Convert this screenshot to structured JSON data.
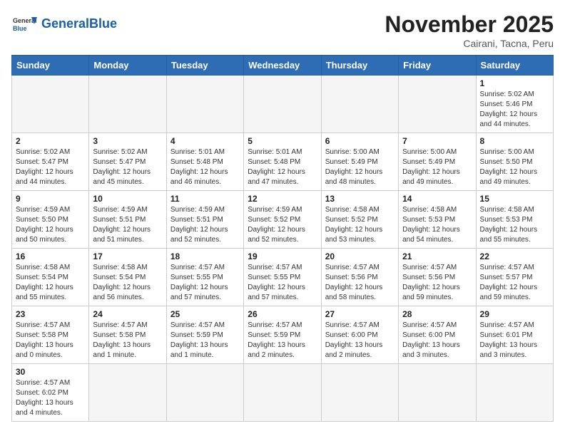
{
  "header": {
    "logo_general": "General",
    "logo_blue": "Blue",
    "month_title": "November 2025",
    "location": "Cairani, Tacna, Peru"
  },
  "weekdays": [
    "Sunday",
    "Monday",
    "Tuesday",
    "Wednesday",
    "Thursday",
    "Friday",
    "Saturday"
  ],
  "days": {
    "d1": {
      "num": "1",
      "info": "Sunrise: 5:02 AM\nSunset: 5:46 PM\nDaylight: 12 hours\nand 44 minutes."
    },
    "d2": {
      "num": "2",
      "info": "Sunrise: 5:02 AM\nSunset: 5:47 PM\nDaylight: 12 hours\nand 44 minutes."
    },
    "d3": {
      "num": "3",
      "info": "Sunrise: 5:02 AM\nSunset: 5:47 PM\nDaylight: 12 hours\nand 45 minutes."
    },
    "d4": {
      "num": "4",
      "info": "Sunrise: 5:01 AM\nSunset: 5:48 PM\nDaylight: 12 hours\nand 46 minutes."
    },
    "d5": {
      "num": "5",
      "info": "Sunrise: 5:01 AM\nSunset: 5:48 PM\nDaylight: 12 hours\nand 47 minutes."
    },
    "d6": {
      "num": "6",
      "info": "Sunrise: 5:00 AM\nSunset: 5:49 PM\nDaylight: 12 hours\nand 48 minutes."
    },
    "d7": {
      "num": "7",
      "info": "Sunrise: 5:00 AM\nSunset: 5:49 PM\nDaylight: 12 hours\nand 49 minutes."
    },
    "d8": {
      "num": "8",
      "info": "Sunrise: 5:00 AM\nSunset: 5:50 PM\nDaylight: 12 hours\nand 49 minutes."
    },
    "d9": {
      "num": "9",
      "info": "Sunrise: 4:59 AM\nSunset: 5:50 PM\nDaylight: 12 hours\nand 50 minutes."
    },
    "d10": {
      "num": "10",
      "info": "Sunrise: 4:59 AM\nSunset: 5:51 PM\nDaylight: 12 hours\nand 51 minutes."
    },
    "d11": {
      "num": "11",
      "info": "Sunrise: 4:59 AM\nSunset: 5:51 PM\nDaylight: 12 hours\nand 52 minutes."
    },
    "d12": {
      "num": "12",
      "info": "Sunrise: 4:59 AM\nSunset: 5:52 PM\nDaylight: 12 hours\nand 52 minutes."
    },
    "d13": {
      "num": "13",
      "info": "Sunrise: 4:58 AM\nSunset: 5:52 PM\nDaylight: 12 hours\nand 53 minutes."
    },
    "d14": {
      "num": "14",
      "info": "Sunrise: 4:58 AM\nSunset: 5:53 PM\nDaylight: 12 hours\nand 54 minutes."
    },
    "d15": {
      "num": "15",
      "info": "Sunrise: 4:58 AM\nSunset: 5:53 PM\nDaylight: 12 hours\nand 55 minutes."
    },
    "d16": {
      "num": "16",
      "info": "Sunrise: 4:58 AM\nSunset: 5:54 PM\nDaylight: 12 hours\nand 55 minutes."
    },
    "d17": {
      "num": "17",
      "info": "Sunrise: 4:58 AM\nSunset: 5:54 PM\nDaylight: 12 hours\nand 56 minutes."
    },
    "d18": {
      "num": "18",
      "info": "Sunrise: 4:57 AM\nSunset: 5:55 PM\nDaylight: 12 hours\nand 57 minutes."
    },
    "d19": {
      "num": "19",
      "info": "Sunrise: 4:57 AM\nSunset: 5:55 PM\nDaylight: 12 hours\nand 57 minutes."
    },
    "d20": {
      "num": "20",
      "info": "Sunrise: 4:57 AM\nSunset: 5:56 PM\nDaylight: 12 hours\nand 58 minutes."
    },
    "d21": {
      "num": "21",
      "info": "Sunrise: 4:57 AM\nSunset: 5:56 PM\nDaylight: 12 hours\nand 59 minutes."
    },
    "d22": {
      "num": "22",
      "info": "Sunrise: 4:57 AM\nSunset: 5:57 PM\nDaylight: 12 hours\nand 59 minutes."
    },
    "d23": {
      "num": "23",
      "info": "Sunrise: 4:57 AM\nSunset: 5:58 PM\nDaylight: 13 hours\nand 0 minutes."
    },
    "d24": {
      "num": "24",
      "info": "Sunrise: 4:57 AM\nSunset: 5:58 PM\nDaylight: 13 hours\nand 1 minute."
    },
    "d25": {
      "num": "25",
      "info": "Sunrise: 4:57 AM\nSunset: 5:59 PM\nDaylight: 13 hours\nand 1 minute."
    },
    "d26": {
      "num": "26",
      "info": "Sunrise: 4:57 AM\nSunset: 5:59 PM\nDaylight: 13 hours\nand 2 minutes."
    },
    "d27": {
      "num": "27",
      "info": "Sunrise: 4:57 AM\nSunset: 6:00 PM\nDaylight: 13 hours\nand 2 minutes."
    },
    "d28": {
      "num": "28",
      "info": "Sunrise: 4:57 AM\nSunset: 6:00 PM\nDaylight: 13 hours\nand 3 minutes."
    },
    "d29": {
      "num": "29",
      "info": "Sunrise: 4:57 AM\nSunset: 6:01 PM\nDaylight: 13 hours\nand 3 minutes."
    },
    "d30": {
      "num": "30",
      "info": "Sunrise: 4:57 AM\nSunset: 6:02 PM\nDaylight: 13 hours\nand 4 minutes."
    }
  }
}
